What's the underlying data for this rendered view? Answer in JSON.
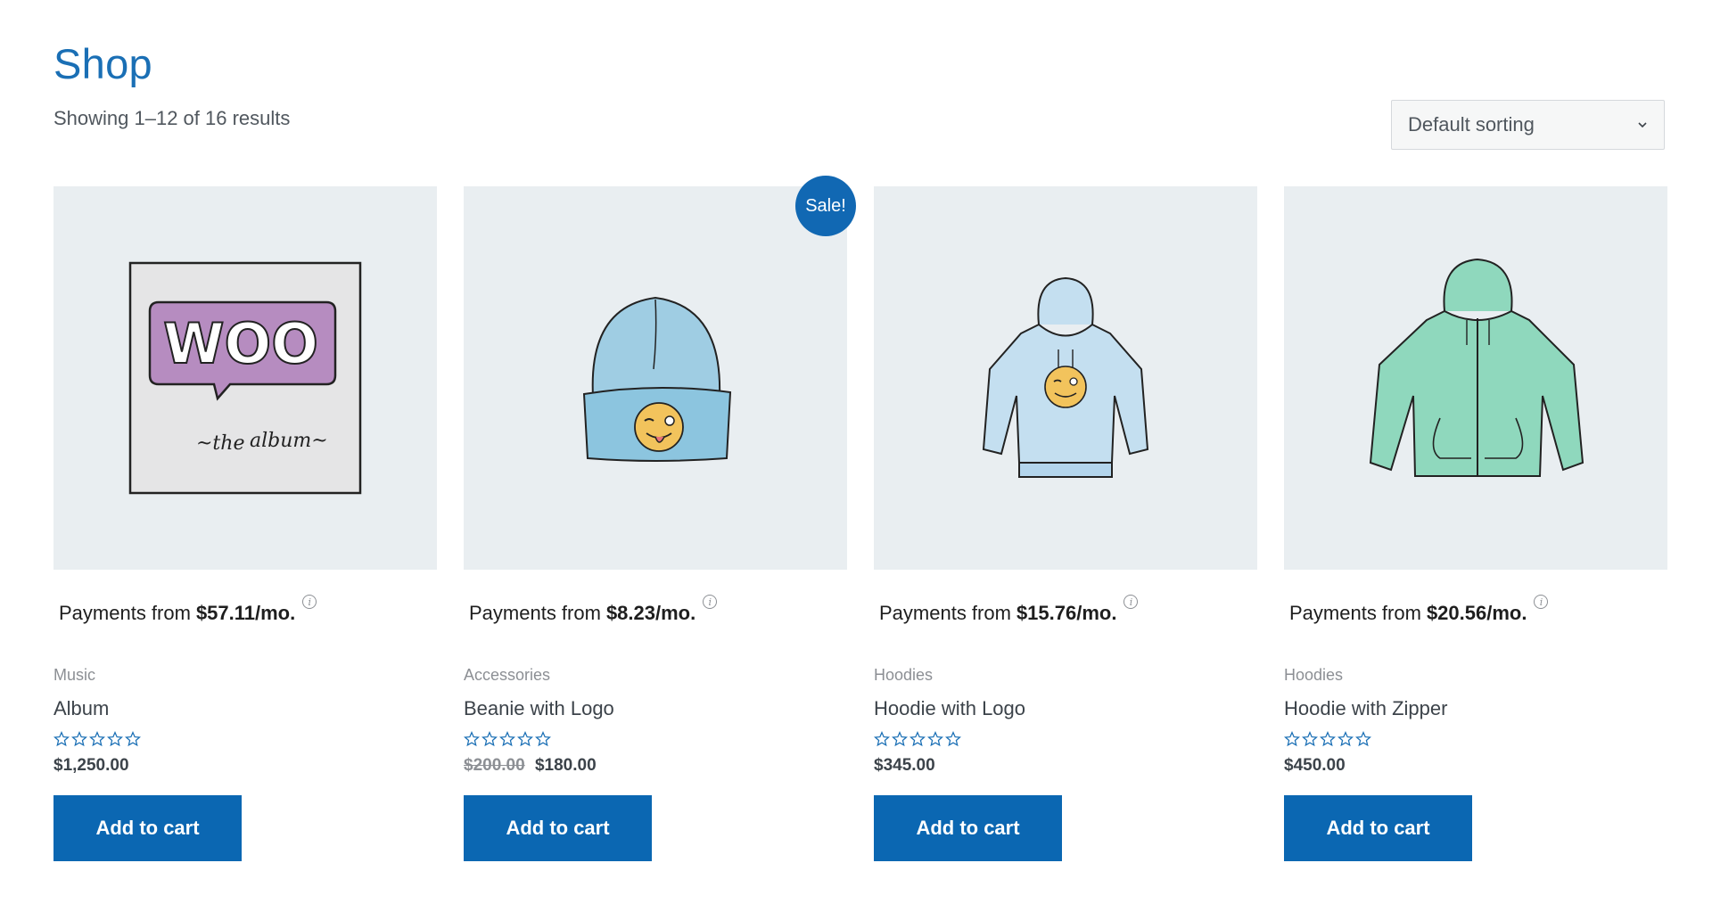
{
  "page": {
    "title": "Shop",
    "result_count": "Showing 1–12 of 16 results",
    "sorting": "Default sorting"
  },
  "colors": {
    "accent": "#0b67b2",
    "title": "#1a6fb5",
    "thumb_bg": "#e9eef1"
  },
  "products": [
    {
      "payments_label": "Payments from",
      "payments_amount": "$57.11/mo.",
      "category": "Music",
      "name": "Album",
      "rating": 0,
      "price": "$1,250.00",
      "old_price": "",
      "button": "Add to cart",
      "image": "album-image"
    },
    {
      "payments_label": "Payments from",
      "payments_amount": "$8.23/mo.",
      "category": "Accessories",
      "name": "Beanie with Logo",
      "rating": 0,
      "price": "$180.00",
      "old_price": "$200.00",
      "sale_badge": "Sale!",
      "button": "Add to cart",
      "image": "beanie-image"
    },
    {
      "payments_label": "Payments from",
      "payments_amount": "$15.76/mo.",
      "category": "Hoodies",
      "name": "Hoodie with Logo",
      "rating": 0,
      "price": "$345.00",
      "old_price": "",
      "button": "Add to cart",
      "image": "hoodie-logo-image"
    },
    {
      "payments_label": "Payments from",
      "payments_amount": "$20.56/mo.",
      "category": "Hoodies",
      "name": "Hoodie with Zipper",
      "rating": 0,
      "price": "$450.00",
      "old_price": "",
      "button": "Add to cart",
      "image": "hoodie-zipper-image"
    }
  ]
}
